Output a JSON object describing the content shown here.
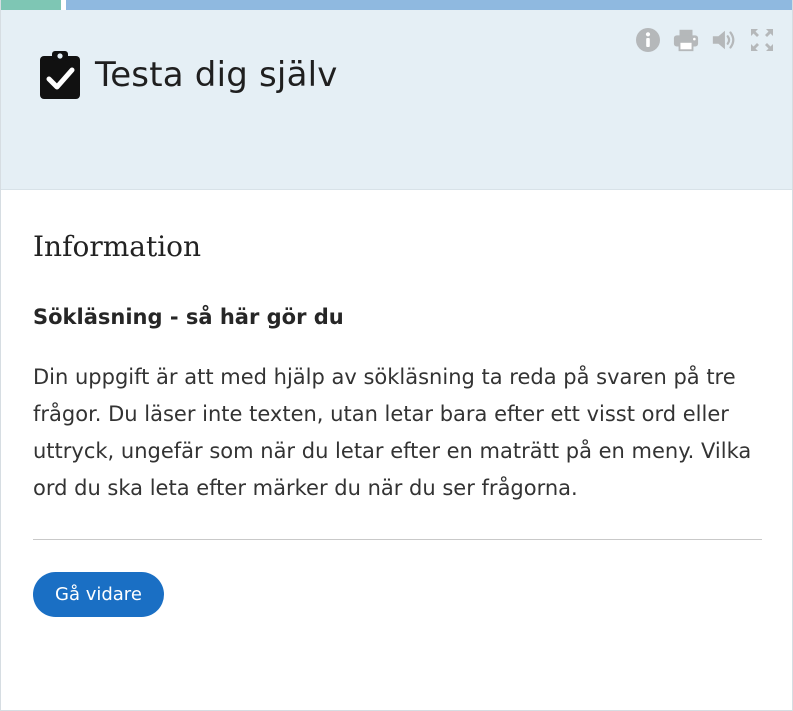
{
  "header": {
    "title": "Testa dig själv"
  },
  "toolbar": {
    "icons": [
      "info-icon",
      "print-icon",
      "speaker-icon",
      "fullscreen-icon"
    ]
  },
  "content": {
    "section_heading": "Information",
    "subheading": "Sökläsning - så här gör du",
    "body": "Din uppgift är att med hjälp av sökläsning ta reda på svaren på tre frågor. Du läser inte texten, utan letar bara efter ett visst ord eller uttryck, ungefär som när du letar efter en maträtt på en meny. Vilka ord du ska leta efter märker du när du ser frågorna."
  },
  "actions": {
    "continue_label": "Gå vidare"
  },
  "colors": {
    "header_bg": "#e5eff5",
    "progress_done": "#7ec6b4",
    "progress_rest": "#8fb9e0",
    "button_bg": "#1a6fc4",
    "icon_gray": "#b5b8ba"
  }
}
